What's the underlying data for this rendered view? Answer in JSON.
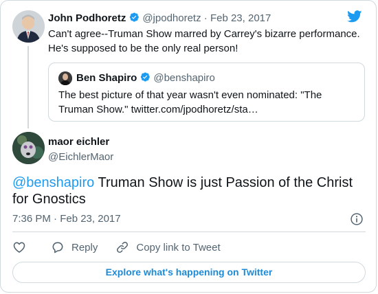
{
  "colors": {
    "accent": "#1d9bf0",
    "muted": "#536471",
    "border": "#cfd9de",
    "text": "#0f1419"
  },
  "icons": [
    "twitter-bird-icon",
    "verified-badge-icon",
    "info-icon",
    "heart-icon",
    "reply-icon",
    "link-icon"
  ],
  "parent_tweet": {
    "name": "John Podhoretz",
    "handle": "@jpodhoretz",
    "separator": "·",
    "date": "Feb 23, 2017",
    "text": "Can't agree--Truman Show marred by Carrey's bizarre performance. He's supposed to be the only real person!"
  },
  "quoted_tweet": {
    "name": "Ben Shapiro",
    "handle": "@benshapiro",
    "text": "The best picture of that year wasn't even nominated: \"The Truman Show.\" twitter.com/jpodhoretz/sta…"
  },
  "tweet": {
    "name": "maor eichler",
    "handle": "@EichlerMaor",
    "mention": "@benshapiro",
    "text": " Truman Show is just Passion of the Christ for Gnostics",
    "timestamp": "7:36 PM · Feb 23, 2017"
  },
  "actions": {
    "reply": "Reply",
    "copy_link": "Copy link to Tweet",
    "explore": "Explore what's happening on Twitter"
  }
}
